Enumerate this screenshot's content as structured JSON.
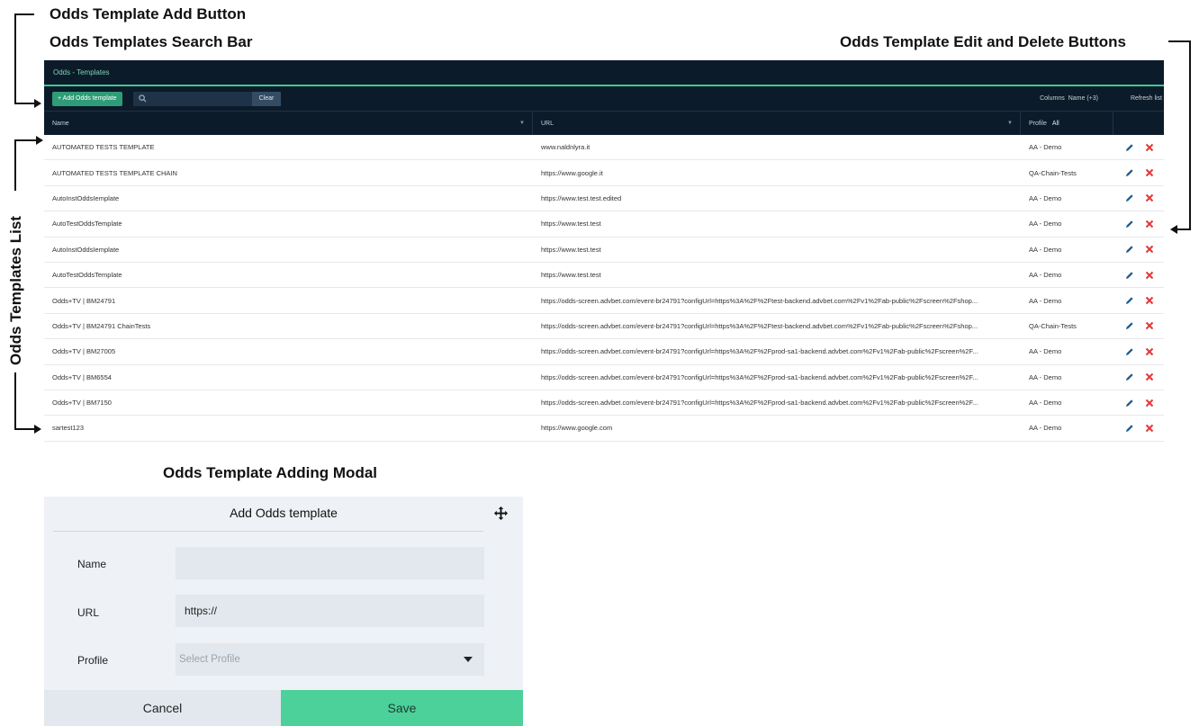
{
  "annotations": {
    "add_button": "Odds Template Add Button",
    "search_bar": "Odds Templates Search  Bar",
    "edit_delete": "Odds Template Edit and Delete Buttons",
    "templates_list": "Odds Templates List",
    "adding_modal": "Odds Template Adding Modal"
  },
  "app": {
    "breadcrumb": "Odds - Templates",
    "toolbar": {
      "add_label": "+ Add Odds template",
      "search_value": "",
      "clear_label": "Clear",
      "columns_label": "Columns",
      "columns_value": "Name (+3)",
      "refresh_label": "Refresh list"
    },
    "columns": {
      "name": "Name",
      "url": "URL",
      "profile": "Profile",
      "profile_filter": "All"
    },
    "rows": [
      {
        "name": "AUTOMATED TESTS TEMPLATE",
        "url": "www.naldnlyra.it",
        "profile": "AA - Demo"
      },
      {
        "name": "AUTOMATED TESTS TEMPLATE CHAIN",
        "url": "https://www.google.it",
        "profile": "QA-Chain-Tests"
      },
      {
        "name": "AutoInstOddsIemplate",
        "url": "https://www.test.test.edited",
        "profile": "AA - Demo"
      },
      {
        "name": "AutoTestOddsTemplate",
        "url": "https://www.test.test",
        "profile": "AA - Demo"
      },
      {
        "name": "AutoInstOddsIemplate",
        "url": "https://www.test.test",
        "profile": "AA - Demo"
      },
      {
        "name": "AutoTestOddsTemplate",
        "url": "https://www.test.test",
        "profile": "AA - Demo"
      },
      {
        "name": "Odds+TV | BM24791",
        "url": "https://odds-screen.advbet.com/event-br24791?configUrl=https%3A%2F%2Ftest-backend.advbet.com%2Fv1%2Fab-public%2Fscreen%2Fshop...",
        "profile": "AA - Demo"
      },
      {
        "name": "Odds+TV | BM24791 ChainTests",
        "url": "https://odds-screen.advbet.com/event-br24791?configUrl=https%3A%2F%2Ftest-backend.advbet.com%2Fv1%2Fab-public%2Fscreen%2Fshop...",
        "profile": "QA-Chain-Tests"
      },
      {
        "name": "Odds+TV | BM27005",
        "url": "https://odds-screen.advbet.com/event-br24791?configUrl=https%3A%2F%2Fprod-sa1-backend.advbet.com%2Fv1%2Fab-public%2Fscreen%2F...",
        "profile": "AA - Demo"
      },
      {
        "name": "Odds+TV | BM6554",
        "url": "https://odds-screen.advbet.com/event-br24791?configUrl=https%3A%2F%2Fprod-sa1-backend.advbet.com%2Fv1%2Fab-public%2Fscreen%2F...",
        "profile": "AA - Demo"
      },
      {
        "name": "Odds+TV | BM7150",
        "url": "https://odds-screen.advbet.com/event-br24791?configUrl=https%3A%2F%2Fprod-sa1-backend.advbet.com%2Fv1%2Fab-public%2Fscreen%2F...",
        "profile": "AA - Demo"
      },
      {
        "name": "sartest123",
        "url": "https://www.google.com",
        "profile": "AA - Demo"
      }
    ],
    "icons": {
      "edit": "pencil-icon",
      "delete": "x-delete-icon",
      "search": "search-icon",
      "move": "move-icon"
    },
    "colors": {
      "header_bg": "#0c1b2a",
      "accent": "#3ec795",
      "delete": "#e53935",
      "edit": "#1e5a8c",
      "save_bg": "#4cd19b"
    }
  },
  "modal": {
    "title": "Add Odds template",
    "name_label": "Name",
    "name_value": "",
    "url_label": "URL",
    "url_value": "https://",
    "profile_label": "Profile",
    "profile_placeholder": "Select Profile",
    "cancel_label": "Cancel",
    "save_label": "Save"
  }
}
